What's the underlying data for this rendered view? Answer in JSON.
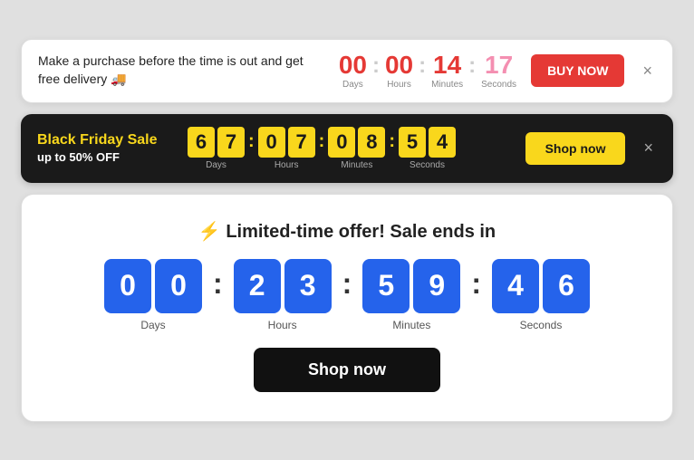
{
  "delivery_banner": {
    "message": "Make a purchase before the time is out and get free delivery 🚚",
    "countdown": {
      "days": {
        "value": "00",
        "label": "Days"
      },
      "hours": {
        "value": "00",
        "label": "Hours"
      },
      "minutes": {
        "value": "14",
        "label": "Minutes"
      },
      "seconds": {
        "value": "17",
        "label": "Seconds"
      }
    },
    "buy_label": "BUY NOW",
    "close_label": "×"
  },
  "bf_banner": {
    "line1": "Black Friday Sale",
    "line2": "up to 50% OFF",
    "countdown": {
      "days": {
        "d1": "6",
        "d2": "7",
        "label": "Days"
      },
      "hours": {
        "d1": "0",
        "d2": "7",
        "label": "Hours"
      },
      "minutes": {
        "d1": "0",
        "d2": "8",
        "label": "Minutes"
      },
      "seconds": {
        "d1": "5",
        "d2": "4",
        "label": "Seconds"
      }
    },
    "shop_label": "Shop now",
    "close_label": "×"
  },
  "sale_banner": {
    "title": "⚡ Limited-time offer! Sale ends in",
    "countdown": {
      "days": {
        "d1": "0",
        "d2": "0",
        "label": "Days"
      },
      "hours": {
        "d1": "2",
        "d2": "3",
        "label": "Hours"
      },
      "minutes": {
        "d1": "5",
        "d2": "9",
        "label": "Minutes"
      },
      "seconds": {
        "d1": "4",
        "d2": "6",
        "label": "Seconds"
      }
    },
    "shop_label": "Shop now"
  }
}
